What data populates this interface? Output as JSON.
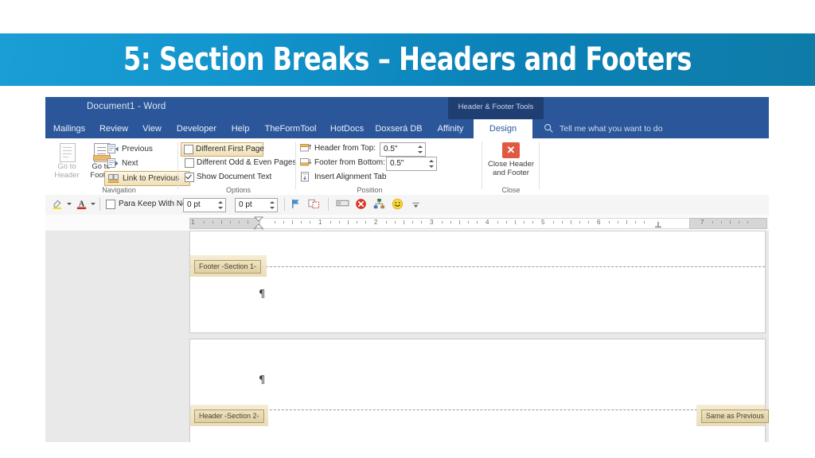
{
  "slide": {
    "title": "5: Section Breaks – Headers and Footers",
    "banner_color_start": "#1a9ed4",
    "banner_color_end": "#0e7ca8"
  },
  "window": {
    "doc_title": "Document1  -  Word",
    "contextual_tools": "Header & Footer Tools",
    "titlebar_color": "#2b579a"
  },
  "tabs": [
    {
      "label": "Mailings",
      "active": false
    },
    {
      "label": "Review",
      "active": false
    },
    {
      "label": "View",
      "active": false
    },
    {
      "label": "Developer",
      "active": false
    },
    {
      "label": "Help",
      "active": false
    },
    {
      "label": "TheFormTool",
      "active": false
    },
    {
      "label": "HotDocs",
      "active": false
    },
    {
      "label": "Doxserá DB",
      "active": false
    },
    {
      "label": "Affinity",
      "active": false
    },
    {
      "label": "Design",
      "active": true
    }
  ],
  "search": {
    "placeholder": "Tell me what you want to do",
    "icon": "search-icon"
  },
  "ribbon": {
    "groups": [
      {
        "name": "Navigation"
      },
      {
        "name": "Options"
      },
      {
        "name": "Position"
      },
      {
        "name": "Close"
      }
    ],
    "navigation": {
      "go_to_header": "Go to\nHeader",
      "go_to_header_line1": "Go to",
      "go_to_header_line2": "Header",
      "go_to_footer_line1": "Go to",
      "go_to_footer_line2": "Footer",
      "previous": "Previous",
      "next": "Next",
      "link_to_previous": "Link to Previous",
      "link_to_previous_highlighted": true,
      "group_label": "Navigation"
    },
    "options": {
      "different_first_page": "Different First Page",
      "different_first_page_checked": false,
      "different_first_page_highlighted": true,
      "different_odd_even": "Different Odd & Even Pages",
      "different_odd_even_checked": false,
      "show_document_text": "Show Document Text",
      "show_document_text_checked": true,
      "group_label": "Options"
    },
    "position": {
      "header_from_top_label": "Header from Top:",
      "header_from_top_value": "0.5\"",
      "footer_from_bottom_label": "Footer from Bottom:",
      "footer_from_bottom_value": "0.5\"",
      "insert_alignment_tab": "Insert Alignment Tab",
      "group_label": "Position"
    },
    "close": {
      "label_line1": "Close Header",
      "label_line2": "and Footer",
      "icon": "close-x-icon",
      "icon_color": "#e05a43",
      "group_label": "Close"
    }
  },
  "toolbar2": {
    "highlight_icon": "text-highlight-icon",
    "font_color_icon": "font-color-icon",
    "para_keep_with_next_label": "Para Keep With Next",
    "para_keep_with_next_checked": false,
    "space_before_value": "0 pt",
    "space_after_value": "0 pt",
    "flag_icon": "flag-icon",
    "compare_icon": "compare-docs-icon",
    "rename_icon": "rectangle-icon",
    "delete_icon": "red-x-circle-icon",
    "org_icon": "org-chart-icon",
    "smiley_icon": "smiley-icon",
    "overflow_icon": "overflow-chevron-icon"
  },
  "ruler": {
    "numbers": [
      "1",
      "1",
      "2",
      "3",
      "4",
      "5",
      "6",
      "7"
    ],
    "unit": "inches",
    "left_indent_marker": "indent-marker",
    "tab_stop_marker": "tab-stop-marker"
  },
  "document": {
    "pages": [
      {
        "name": "page-1",
        "tags": [
          {
            "text": "Footer -Section 1-",
            "position": "top-left"
          }
        ],
        "pilcrow": "¶"
      },
      {
        "name": "page-2",
        "tags": [
          {
            "text": "Header -Section 2-",
            "position": "bottom-left"
          },
          {
            "text": "Same as Previous",
            "position": "bottom-right"
          }
        ],
        "pilcrow": "¶"
      }
    ],
    "tag_bg": "#e5d7ae",
    "tag_border": "#b39c63"
  }
}
